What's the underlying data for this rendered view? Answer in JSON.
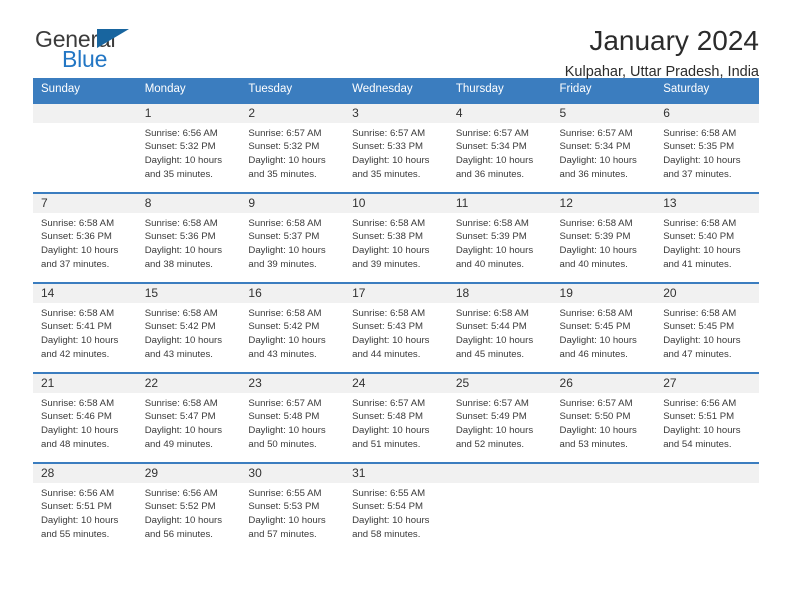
{
  "brand": {
    "name_part1": "General",
    "name_part2": "Blue",
    "mark_icon": "triangle-flag-icon"
  },
  "header": {
    "title": "January 2024",
    "subtitle": "Kulpahar, Uttar Pradesh, India"
  },
  "calendar": {
    "weekday_headers": [
      "Sunday",
      "Monday",
      "Tuesday",
      "Wednesday",
      "Thursday",
      "Friday",
      "Saturday"
    ],
    "labels": {
      "sunrise_prefix": "Sunrise:",
      "sunset_prefix": "Sunset:",
      "daylight_prefix": "Daylight:"
    },
    "colors": {
      "header_blue": "#3b7dbf",
      "daynum_gray": "#f1f1f1",
      "brand_blue": "#2276c4",
      "mark_blue": "#18659f"
    },
    "weeks": [
      [
        {
          "day": "",
          "sunrise": "",
          "sunset": "",
          "daylight": ""
        },
        {
          "day": "1",
          "sunrise": "Sunrise: 6:56 AM",
          "sunset": "Sunset: 5:32 PM",
          "daylight": "Daylight: 10 hours and 35 minutes."
        },
        {
          "day": "2",
          "sunrise": "Sunrise: 6:57 AM",
          "sunset": "Sunset: 5:32 PM",
          "daylight": "Daylight: 10 hours and 35 minutes."
        },
        {
          "day": "3",
          "sunrise": "Sunrise: 6:57 AM",
          "sunset": "Sunset: 5:33 PM",
          "daylight": "Daylight: 10 hours and 35 minutes."
        },
        {
          "day": "4",
          "sunrise": "Sunrise: 6:57 AM",
          "sunset": "Sunset: 5:34 PM",
          "daylight": "Daylight: 10 hours and 36 minutes."
        },
        {
          "day": "5",
          "sunrise": "Sunrise: 6:57 AM",
          "sunset": "Sunset: 5:34 PM",
          "daylight": "Daylight: 10 hours and 36 minutes."
        },
        {
          "day": "6",
          "sunrise": "Sunrise: 6:58 AM",
          "sunset": "Sunset: 5:35 PM",
          "daylight": "Daylight: 10 hours and 37 minutes."
        }
      ],
      [
        {
          "day": "7",
          "sunrise": "Sunrise: 6:58 AM",
          "sunset": "Sunset: 5:36 PM",
          "daylight": "Daylight: 10 hours and 37 minutes."
        },
        {
          "day": "8",
          "sunrise": "Sunrise: 6:58 AM",
          "sunset": "Sunset: 5:36 PM",
          "daylight": "Daylight: 10 hours and 38 minutes."
        },
        {
          "day": "9",
          "sunrise": "Sunrise: 6:58 AM",
          "sunset": "Sunset: 5:37 PM",
          "daylight": "Daylight: 10 hours and 39 minutes."
        },
        {
          "day": "10",
          "sunrise": "Sunrise: 6:58 AM",
          "sunset": "Sunset: 5:38 PM",
          "daylight": "Daylight: 10 hours and 39 minutes."
        },
        {
          "day": "11",
          "sunrise": "Sunrise: 6:58 AM",
          "sunset": "Sunset: 5:39 PM",
          "daylight": "Daylight: 10 hours and 40 minutes."
        },
        {
          "day": "12",
          "sunrise": "Sunrise: 6:58 AM",
          "sunset": "Sunset: 5:39 PM",
          "daylight": "Daylight: 10 hours and 40 minutes."
        },
        {
          "day": "13",
          "sunrise": "Sunrise: 6:58 AM",
          "sunset": "Sunset: 5:40 PM",
          "daylight": "Daylight: 10 hours and 41 minutes."
        }
      ],
      [
        {
          "day": "14",
          "sunrise": "Sunrise: 6:58 AM",
          "sunset": "Sunset: 5:41 PM",
          "daylight": "Daylight: 10 hours and 42 minutes."
        },
        {
          "day": "15",
          "sunrise": "Sunrise: 6:58 AM",
          "sunset": "Sunset: 5:42 PM",
          "daylight": "Daylight: 10 hours and 43 minutes."
        },
        {
          "day": "16",
          "sunrise": "Sunrise: 6:58 AM",
          "sunset": "Sunset: 5:42 PM",
          "daylight": "Daylight: 10 hours and 43 minutes."
        },
        {
          "day": "17",
          "sunrise": "Sunrise: 6:58 AM",
          "sunset": "Sunset: 5:43 PM",
          "daylight": "Daylight: 10 hours and 44 minutes."
        },
        {
          "day": "18",
          "sunrise": "Sunrise: 6:58 AM",
          "sunset": "Sunset: 5:44 PM",
          "daylight": "Daylight: 10 hours and 45 minutes."
        },
        {
          "day": "19",
          "sunrise": "Sunrise: 6:58 AM",
          "sunset": "Sunset: 5:45 PM",
          "daylight": "Daylight: 10 hours and 46 minutes."
        },
        {
          "day": "20",
          "sunrise": "Sunrise: 6:58 AM",
          "sunset": "Sunset: 5:45 PM",
          "daylight": "Daylight: 10 hours and 47 minutes."
        }
      ],
      [
        {
          "day": "21",
          "sunrise": "Sunrise: 6:58 AM",
          "sunset": "Sunset: 5:46 PM",
          "daylight": "Daylight: 10 hours and 48 minutes."
        },
        {
          "day": "22",
          "sunrise": "Sunrise: 6:58 AM",
          "sunset": "Sunset: 5:47 PM",
          "daylight": "Daylight: 10 hours and 49 minutes."
        },
        {
          "day": "23",
          "sunrise": "Sunrise: 6:57 AM",
          "sunset": "Sunset: 5:48 PM",
          "daylight": "Daylight: 10 hours and 50 minutes."
        },
        {
          "day": "24",
          "sunrise": "Sunrise: 6:57 AM",
          "sunset": "Sunset: 5:48 PM",
          "daylight": "Daylight: 10 hours and 51 minutes."
        },
        {
          "day": "25",
          "sunrise": "Sunrise: 6:57 AM",
          "sunset": "Sunset: 5:49 PM",
          "daylight": "Daylight: 10 hours and 52 minutes."
        },
        {
          "day": "26",
          "sunrise": "Sunrise: 6:57 AM",
          "sunset": "Sunset: 5:50 PM",
          "daylight": "Daylight: 10 hours and 53 minutes."
        },
        {
          "day": "27",
          "sunrise": "Sunrise: 6:56 AM",
          "sunset": "Sunset: 5:51 PM",
          "daylight": "Daylight: 10 hours and 54 minutes."
        }
      ],
      [
        {
          "day": "28",
          "sunrise": "Sunrise: 6:56 AM",
          "sunset": "Sunset: 5:51 PM",
          "daylight": "Daylight: 10 hours and 55 minutes."
        },
        {
          "day": "29",
          "sunrise": "Sunrise: 6:56 AM",
          "sunset": "Sunset: 5:52 PM",
          "daylight": "Daylight: 10 hours and 56 minutes."
        },
        {
          "day": "30",
          "sunrise": "Sunrise: 6:55 AM",
          "sunset": "Sunset: 5:53 PM",
          "daylight": "Daylight: 10 hours and 57 minutes."
        },
        {
          "day": "31",
          "sunrise": "Sunrise: 6:55 AM",
          "sunset": "Sunset: 5:54 PM",
          "daylight": "Daylight: 10 hours and 58 minutes."
        },
        {
          "day": "",
          "sunrise": "",
          "sunset": "",
          "daylight": ""
        },
        {
          "day": "",
          "sunrise": "",
          "sunset": "",
          "daylight": ""
        },
        {
          "day": "",
          "sunrise": "",
          "sunset": "",
          "daylight": ""
        }
      ]
    ]
  }
}
